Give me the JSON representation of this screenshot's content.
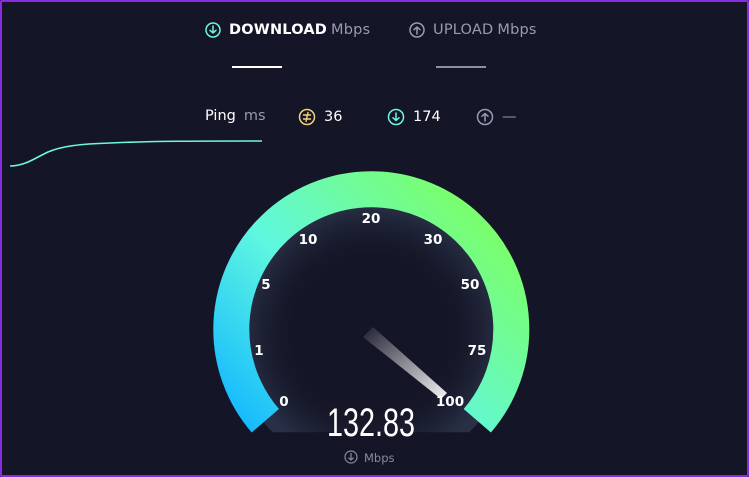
{
  "tabs": {
    "download": {
      "label": "DOWNLOAD",
      "unit": "Mbps"
    },
    "upload": {
      "label": "UPLOAD",
      "unit": "Mbps"
    }
  },
  "ping": {
    "label": "Ping",
    "unit": "ms",
    "idle": "36",
    "download": "174",
    "upload": "—"
  },
  "gauge": {
    "ticks": [
      "0",
      "1",
      "5",
      "10",
      "20",
      "30",
      "50",
      "75",
      "100"
    ],
    "value": "132.83",
    "unit": "Mbps",
    "needle_value": 100
  },
  "colors": {
    "background": "#141526",
    "accent_cyan": "#6ff7df",
    "gauge_start": "#13b8ff",
    "gauge_mid": "#5ff7e0",
    "gauge_end": "#7cff66",
    "ping_idle": "#f3d17a",
    "download_icon": "#6ff7df",
    "upload_icon": "#9a9bb0"
  },
  "icons": {
    "download": "download-arrow-icon",
    "upload": "upload-arrow-icon",
    "idle_ping": "idle-ping-icon"
  }
}
